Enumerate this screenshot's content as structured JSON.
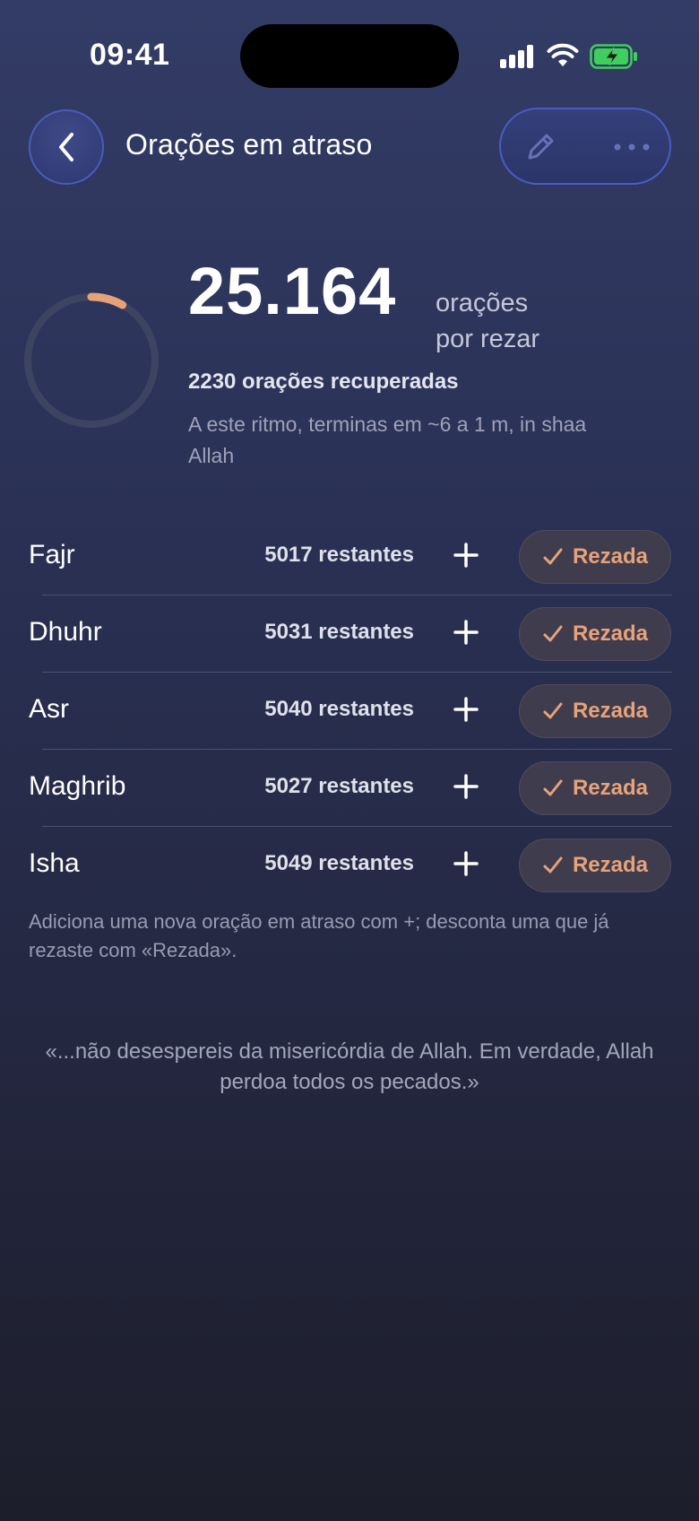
{
  "status_bar": {
    "time": "09:41"
  },
  "header": {
    "title": "Orações em atraso",
    "back_icon": "chevron-left-icon",
    "edit_icon": "pencil-icon",
    "more_icon": "ellipsis-icon"
  },
  "summary": {
    "total_pending": "25.164",
    "unit_line1": "orações",
    "unit_line2": "por rezar",
    "recovered": "2230 orações recuperadas",
    "estimate": "A este ritmo, terminas em ~6 a 1 m, in shaa Allah",
    "progress_fraction": 0.081,
    "accent_color": "#e8a27a"
  },
  "prayers": [
    {
      "name": "Fajr",
      "remaining": "5017 restantes",
      "add_icon": "plus-icon",
      "prayed_label": "Rezada"
    },
    {
      "name": "Dhuhr",
      "remaining": "5031 restantes",
      "add_icon": "plus-icon",
      "prayed_label": "Rezada"
    },
    {
      "name": "Asr",
      "remaining": "5040 restantes",
      "add_icon": "plus-icon",
      "prayed_label": "Rezada"
    },
    {
      "name": "Maghrib",
      "remaining": "5027 restantes",
      "add_icon": "plus-icon",
      "prayed_label": "Rezada"
    },
    {
      "name": "Isha",
      "remaining": "5049 restantes",
      "add_icon": "plus-icon",
      "prayed_label": "Rezada"
    }
  ],
  "hint": "Adiciona uma nova oração em atraso com +; desconta uma que já rezaste com «Rezada».",
  "quote": "«...não desespereis da misericórdia de Allah. Em verdade, Allah perdoa todos os pecados.»"
}
